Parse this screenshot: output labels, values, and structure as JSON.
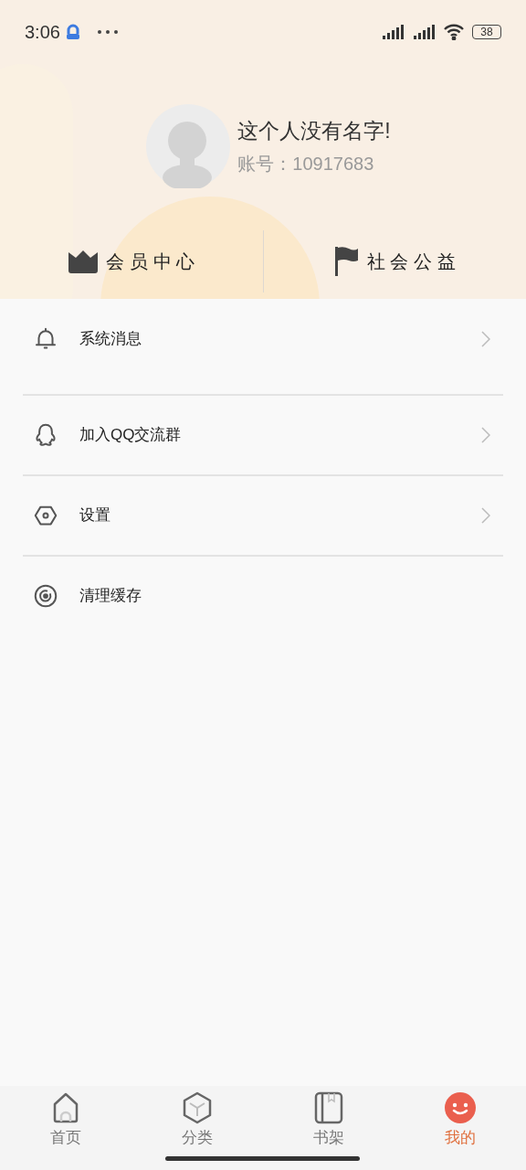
{
  "status_bar": {
    "time": "3:06",
    "battery": "38"
  },
  "profile": {
    "name": "这个人没有名字!",
    "account": "账号：10917683"
  },
  "shortcuts": [
    {
      "kind": "crown",
      "label": "会 员 中 心"
    },
    {
      "kind": "flag",
      "label": "社 会 公 益"
    }
  ],
  "menu": [
    {
      "kind": "bell",
      "label": "系统消息",
      "chevron": true
    },
    {
      "kind": "qq",
      "label": "加入QQ交流群",
      "chevron": true
    },
    {
      "kind": "settings",
      "label": "设置",
      "chevron": true
    },
    {
      "kind": "clean",
      "label": "清理缓存",
      "chevron": false
    }
  ],
  "tab_bar": [
    {
      "kind": "home",
      "label": "首页",
      "selected": false
    },
    {
      "kind": "category",
      "label": "分类",
      "selected": false
    },
    {
      "kind": "shelf",
      "label": "书架",
      "selected": false
    },
    {
      "kind": "me",
      "label": "我的",
      "selected": true
    }
  ]
}
